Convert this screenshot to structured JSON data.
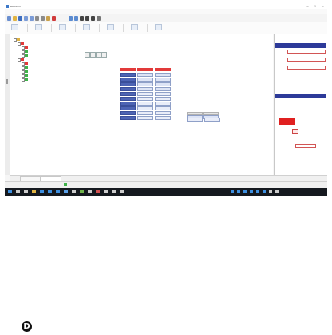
{
  "window": {
    "title": "Geometrix",
    "minimize_glyph": "–",
    "maximize_glyph": "□",
    "close_glyph": "×"
  },
  "menu": [],
  "toolbar_icons": [
    {
      "icon": "new-file-icon",
      "color": "#6a8fd0"
    },
    {
      "icon": "open-folder-icon",
      "color": "#e0b341"
    },
    {
      "icon": "save-icon",
      "color": "#3e6ec0"
    },
    {
      "icon": "undo-icon",
      "color": "#7a9bd6"
    },
    {
      "icon": "redo-icon",
      "color": "#7a9bd6"
    },
    {
      "icon": "cut-icon",
      "color": "#8a8a8a"
    },
    {
      "icon": "copy-icon",
      "color": "#8a8a8a"
    },
    {
      "icon": "paste-icon",
      "color": "#c9a04a"
    },
    {
      "icon": "delete-icon",
      "color": "#d03a3a"
    },
    {
      "icon": "zoom-icon",
      "color": "#5b8bd0"
    },
    {
      "icon": "pan-icon",
      "color": "#5b8bd0"
    },
    {
      "icon": "measure-icon",
      "color": "#444444"
    },
    {
      "icon": "grid-icon",
      "color": "#444444"
    },
    {
      "icon": "layers-icon",
      "color": "#444444"
    },
    {
      "icon": "settings-icon",
      "color": "#777777"
    }
  ],
  "ribbon": {
    "groups": [
      {
        "icon": "section-icon",
        "label": ""
      },
      {
        "icon": "material-icon",
        "label": ""
      },
      {
        "icon": "load-icon",
        "label": ""
      },
      {
        "icon": "analysis-icon",
        "label": ""
      },
      {
        "icon": "report-icon",
        "label": ""
      },
      {
        "icon": "export-icon",
        "label": ""
      },
      {
        "icon": "options-icon",
        "label": ""
      }
    ]
  },
  "tree": {
    "nodes": [
      {
        "level": 0,
        "icon": "folder-icon",
        "icon_color": "#e0b341",
        "label": "",
        "expanded": true
      },
      {
        "level": 1,
        "icon": "profile-icon",
        "icon_color": "#e23a3a",
        "label": "",
        "expanded": true
      },
      {
        "level": 2,
        "icon": "profile-icon",
        "icon_color": "#e23a3a",
        "label": "",
        "expanded": false
      },
      {
        "level": 2,
        "icon": "element-icon",
        "icon_color": "#3fb24a",
        "label": "",
        "expanded": false
      },
      {
        "level": 2,
        "icon": "element-icon",
        "icon_color": "#3fb24a",
        "label": "",
        "expanded": false
      },
      {
        "level": 1,
        "icon": "profile-icon",
        "icon_color": "#e23a3a",
        "label": "",
        "expanded": true
      },
      {
        "level": 2,
        "icon": "profile-icon",
        "icon_color": "#e23a3a",
        "label": "",
        "expanded": false
      },
      {
        "level": 2,
        "icon": "element-icon",
        "icon_color": "#3fb24a",
        "label": "",
        "expanded": false,
        "selected": true
      },
      {
        "level": 2,
        "icon": "element-icon",
        "icon_color": "#3fb24a",
        "label": "",
        "expanded": false
      },
      {
        "level": 2,
        "icon": "element-icon",
        "icon_color": "#3fb24a",
        "label": "",
        "expanded": false
      },
      {
        "level": 2,
        "icon": "element-icon",
        "icon_color": "#3fb24a",
        "label": "",
        "expanded": false
      }
    ]
  },
  "main": {
    "title": "",
    "subtitle": "",
    "description": "",
    "header_right": "",
    "controls": [
      "first-icon",
      "prev-icon",
      "next-icon",
      "last-icon"
    ],
    "section_label": "",
    "rows": [
      {
        "label": "",
        "unit": "",
        "cells": [
          "",
          "",
          ""
        ],
        "styles": [
          "dark",
          "normal",
          "normal"
        ]
      },
      {
        "label": "",
        "unit": "",
        "cells": [
          "",
          "",
          ""
        ],
        "styles": [
          "dark",
          "normal",
          "normal"
        ]
      },
      {
        "label": "",
        "unit": "",
        "cells": [
          "",
          "",
          ""
        ],
        "styles": [
          "dark",
          "normal",
          "normal"
        ]
      },
      {
        "label": "",
        "unit": "",
        "cells": [
          "",
          "",
          ""
        ],
        "styles": [
          "dark",
          "normal",
          "normal"
        ]
      },
      {
        "label": "",
        "unit": "",
        "cells": [
          "",
          "",
          ""
        ],
        "styles": [
          "dark",
          "light",
          "light"
        ]
      },
      {
        "label": "",
        "unit": "",
        "cells": [
          "",
          "",
          ""
        ],
        "styles": [
          "dark",
          "light",
          "light"
        ]
      },
      {
        "label": "",
        "unit": "",
        "cells": [
          "",
          "",
          ""
        ],
        "styles": [
          "dark",
          "light",
          "light"
        ]
      },
      {
        "label": "",
        "unit": "",
        "cells": [
          "",
          "",
          ""
        ],
        "styles": [
          "dark",
          "light",
          "light"
        ]
      },
      {
        "label": "",
        "unit": "",
        "cells": [
          "",
          "",
          ""
        ],
        "styles": [
          "dark",
          "light",
          "light"
        ]
      },
      {
        "label": "",
        "unit": "",
        "cells": [
          "",
          "",
          ""
        ],
        "styles": [
          "dark",
          "light",
          "light"
        ]
      }
    ],
    "mini_table": {
      "headers": [
        "",
        ""
      ],
      "values": [
        "",
        ""
      ]
    },
    "extra_cells": [
      "",
      ""
    ]
  },
  "right_panel": {
    "header1": "",
    "fields": [
      {
        "label": "",
        "value": ""
      },
      {
        "label": "",
        "value": ""
      },
      {
        "label": "",
        "value": ""
      }
    ],
    "extra_label": "",
    "header2": "",
    "bottom_label": "",
    "bottom_value": ""
  },
  "bottom_tabs": [
    "",
    ""
  ],
  "status": [
    "",
    "",
    ""
  ],
  "taskbar": {
    "icons": [
      {
        "icon": "start-icon",
        "color": "#3d8fe0"
      },
      {
        "icon": "search-icon",
        "color": "#cccccc"
      },
      {
        "icon": "taskview-icon",
        "color": "#cccccc"
      },
      {
        "icon": "folder-icon",
        "color": "#e0b341"
      },
      {
        "icon": "browser-icon",
        "color": "#3d8fe0"
      },
      {
        "icon": "mail-icon",
        "color": "#3d8fe0"
      },
      {
        "icon": "store-icon",
        "color": "#3d8fe0"
      },
      {
        "icon": "app-icon",
        "color": "#5aa0e8"
      },
      {
        "icon": "app-icon",
        "color": "#cccccc"
      },
      {
        "icon": "app-icon",
        "color": "#6fb24a"
      },
      {
        "icon": "app-icon",
        "color": "#cccccc"
      },
      {
        "icon": "app-icon",
        "color": "#d05050"
      },
      {
        "icon": "app-icon",
        "color": "#cccccc"
      },
      {
        "icon": "app-icon",
        "color": "#cccccc"
      },
      {
        "icon": "app-icon",
        "color": "#cccccc"
      }
    ],
    "tray_icons": [
      {
        "icon": "tray-icon",
        "color": "#3d8fe0"
      },
      {
        "icon": "tray-icon",
        "color": "#3d8fe0"
      },
      {
        "icon": "tray-icon",
        "color": "#3d8fe0"
      },
      {
        "icon": "tray-icon",
        "color": "#3d8fe0"
      },
      {
        "icon": "tray-icon",
        "color": "#3d8fe0"
      },
      {
        "icon": "tray-icon",
        "color": "#3d8fe0"
      },
      {
        "icon": "tray-icon",
        "color": "#cccccc"
      },
      {
        "icon": "tray-icon",
        "color": "#cccccc"
      }
    ],
    "clock": ""
  },
  "marker": {
    "glyph": "D"
  },
  "colors": {
    "accent_red": "#e23a3a",
    "accent_blue": "#4d64b4",
    "panel_header": "#2d3a99",
    "selection": "#2f8fe6",
    "taskbar": "#15191f"
  }
}
